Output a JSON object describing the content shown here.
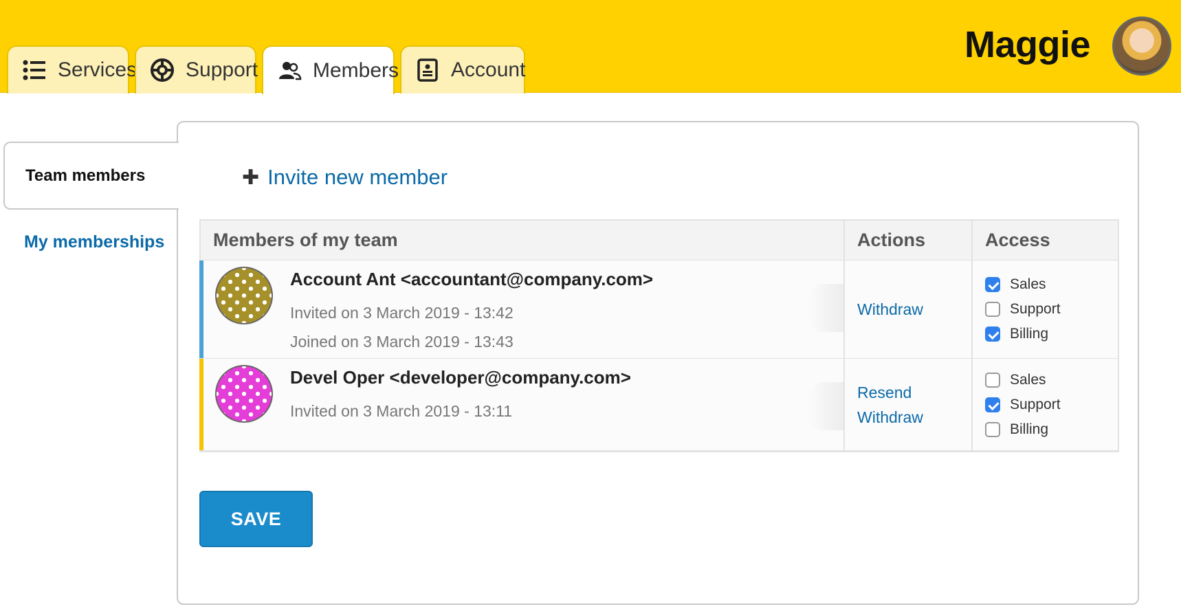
{
  "header": {
    "tabs": [
      {
        "label": "Services",
        "icon": "list-icon",
        "active": false
      },
      {
        "label": "Support",
        "icon": "lifebuoy-icon",
        "active": false
      },
      {
        "label": "Members",
        "icon": "users-icon",
        "active": true
      },
      {
        "label": "Account",
        "icon": "id-card-icon",
        "active": false
      }
    ],
    "user_name": "Maggie",
    "brand_color": "#ffd100"
  },
  "sidebar": {
    "items": [
      {
        "label": "Team members",
        "active": true
      },
      {
        "label": "My memberships",
        "active": false
      }
    ]
  },
  "main": {
    "invite_label": "Invite new member",
    "table": {
      "headers": [
        "Members of my team",
        "Actions",
        "Access"
      ],
      "rows": [
        {
          "name": "Account Ant <accountant@company.com>",
          "invited": "Invited on 3 March 2019 - 13:42",
          "joined": "Joined on 3 March 2019 - 13:43",
          "stripe_color": "#4aa3d8",
          "actions": [
            "Withdraw"
          ],
          "access": [
            {
              "label": "Sales",
              "checked": true
            },
            {
              "label": "Support",
              "checked": false
            },
            {
              "label": "Billing",
              "checked": true
            }
          ]
        },
        {
          "name": "Devel Oper <developer@company.com>",
          "invited": "Invited on 3 March 2019 - 13:11",
          "stripe_color": "#f5c400",
          "actions": [
            "Resend",
            "Withdraw"
          ],
          "access": [
            {
              "label": "Sales",
              "checked": false
            },
            {
              "label": "Support",
              "checked": true
            },
            {
              "label": "Billing",
              "checked": false
            }
          ]
        }
      ]
    },
    "save_label": "SAVE"
  }
}
